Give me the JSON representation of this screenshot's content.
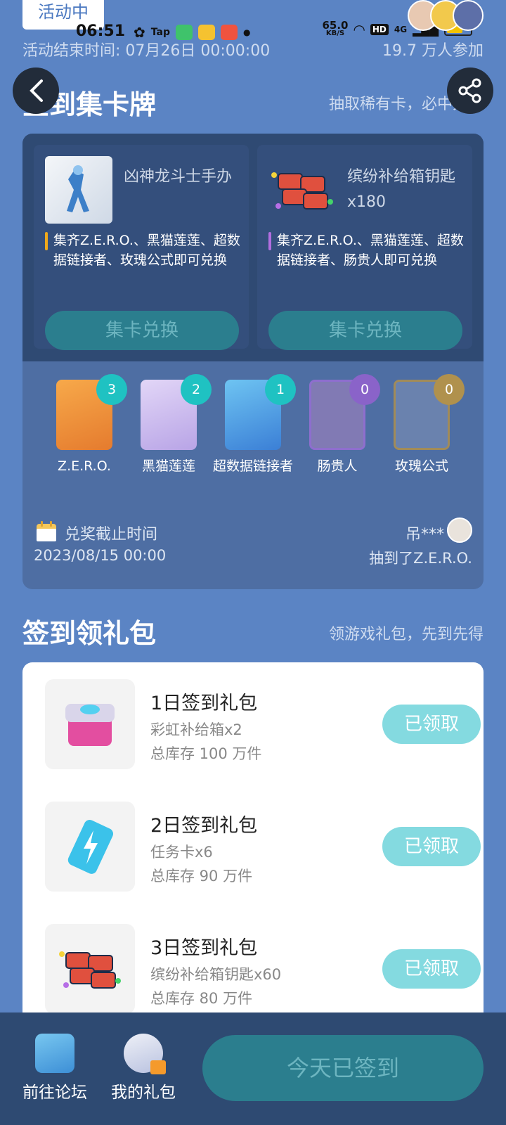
{
  "status": {
    "time": "06:51",
    "tap_label": "Tap",
    "net_speed_value": "65.0",
    "net_speed_unit": "KB/S",
    "hd_label": "HD",
    "signal_label": "4G"
  },
  "activity": {
    "tag": "活动中",
    "end_time": "活动结束时间: 07月26日 00:00:00",
    "participants": "19.7 万人参加"
  },
  "collect": {
    "title": "签到集卡牌",
    "subtitle": "抽取稀有卡，必中大奖",
    "prizes": [
      {
        "name": "凶神龙斗士手办",
        "desc": "集齐Z.E.R.O.、黑猫莲莲、超数据链接者、玫瑰公式即可兑换",
        "button": "集卡兑换",
        "bar_color": "#f0a91b"
      },
      {
        "name": "缤纷补给箱钥匙x180",
        "desc": "集齐Z.E.R.O.、黑猫莲莲、超数据链接者、肠贵人即可兑换",
        "button": "集卡兑换",
        "bar_color": "#b26ee0"
      }
    ],
    "cards": [
      {
        "name": "Z.E.R.O.",
        "count": "3",
        "badge_color": "#1fc2c2"
      },
      {
        "name": "黑猫莲莲",
        "count": "2",
        "badge_color": "#1fc2c2"
      },
      {
        "name": "超数据链接者",
        "count": "1",
        "badge_color": "#1fc2c2"
      },
      {
        "name": "肠贵人",
        "count": "0",
        "badge_color": "#8a63c9"
      },
      {
        "name": "玫瑰公式",
        "count": "0",
        "badge_color": "#b0914d"
      }
    ],
    "deadline_label": "兑奖截止时间",
    "deadline_value": "2023/08/15 00:00",
    "winner_name": "吊***",
    "winner_text": "抽到了Z.E.R.O."
  },
  "gifts": {
    "title": "签到领礼包",
    "subtitle": "领游戏礼包，先到先得",
    "items": [
      {
        "title": "1日签到礼包",
        "item": "彩虹补给箱x2",
        "stock": "总库存 100 万件",
        "button": "已领取"
      },
      {
        "title": "2日签到礼包",
        "item": "任务卡x6",
        "stock": "总库存 90 万件",
        "button": "已领取"
      },
      {
        "title": "3日签到礼包",
        "item": "缤纷补给箱钥匙x60",
        "stock": "总库存 80 万件",
        "button": "已领取"
      }
    ]
  },
  "bottom": {
    "forum_label": "前往论坛",
    "mygift_label": "我的礼包",
    "sign_button": "今天已签到"
  }
}
